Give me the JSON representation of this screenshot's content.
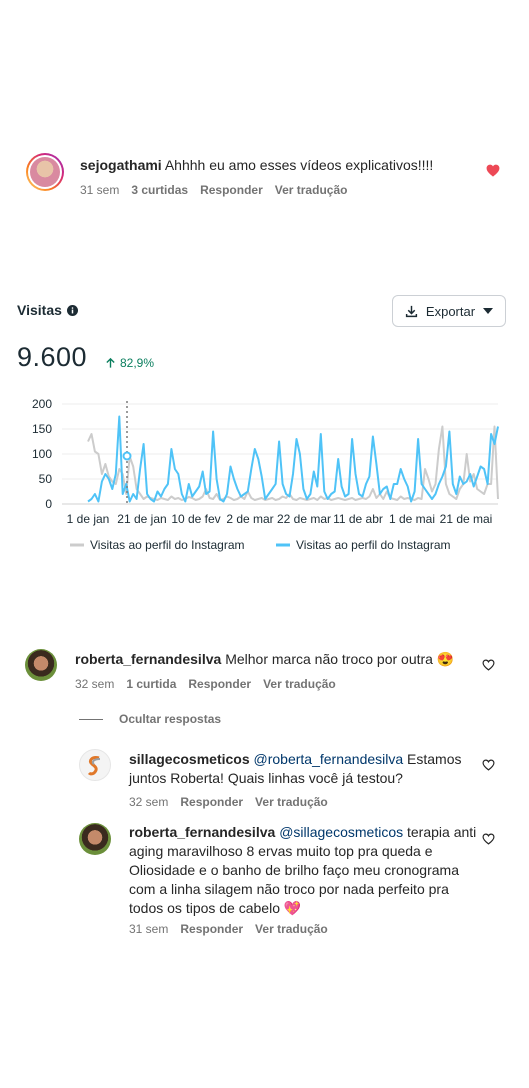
{
  "comment1": {
    "username": "sejogathami",
    "text": "Ahhhh eu amo esses vídeos explicativos!!!!",
    "time": "31 sem",
    "likes": "3 curtidas",
    "reply": "Responder",
    "translate": "Ver tradução",
    "liked": true,
    "like_color": "#ed4956"
  },
  "analytics": {
    "title": "Visitas",
    "info_icon": "info-icon",
    "export_label": "Exportar",
    "total": "9.600",
    "change": "82,9%",
    "change_color": "#0a7e5e"
  },
  "chart_data": {
    "type": "line",
    "y_ticks": [
      "200",
      "150",
      "100",
      "50",
      "0"
    ],
    "ylim": [
      0,
      200
    ],
    "x_ticks": [
      "1 de jan",
      "21 de jan",
      "10 de fev",
      "2 de mar",
      "22 de mar",
      "11 de abr",
      "1 de mai",
      "21 de mai"
    ],
    "grid": true,
    "legend_position": "bottom",
    "series": [
      {
        "name": "Visitas ao perfil do Instagram",
        "color": "#cccccc",
        "values": [
          125,
          140,
          105,
          100,
          60,
          80,
          55,
          45,
          40,
          70,
          60,
          20,
          95,
          75,
          30,
          20,
          10,
          15,
          12,
          10,
          8,
          12,
          10,
          8,
          15,
          10,
          12,
          8,
          10,
          14,
          12,
          8,
          10,
          15,
          30,
          12,
          10,
          20,
          8,
          10,
          15,
          12,
          8,
          10,
          15,
          10,
          25,
          12,
          8,
          10,
          12,
          8,
          10,
          12,
          8,
          10,
          15,
          12,
          20,
          10,
          8,
          12,
          10,
          8,
          10,
          12,
          8,
          15,
          10,
          12,
          8,
          10,
          12,
          10,
          8,
          10,
          12,
          8,
          10,
          12,
          10,
          15,
          30,
          12,
          20,
          10,
          25,
          12,
          10,
          8,
          15,
          10,
          12,
          10,
          8,
          12,
          10,
          70,
          50,
          25,
          40,
          110,
          155,
          40,
          20,
          15,
          10,
          30,
          40,
          100,
          45,
          60,
          30,
          25,
          20,
          40,
          40,
          155,
          10
        ]
      },
      {
        "name": "Visitas ao perfil do Instagram",
        "color": "#4fc3f7",
        "values": [
          5,
          10,
          20,
          5,
          45,
          60,
          50,
          30,
          60,
          175,
          20,
          40,
          5,
          20,
          10,
          70,
          120,
          20,
          10,
          5,
          25,
          15,
          30,
          40,
          110,
          70,
          60,
          20,
          5,
          40,
          15,
          25,
          35,
          65,
          20,
          25,
          145,
          50,
          10,
          5,
          20,
          75,
          50,
          30,
          15,
          20,
          25,
          70,
          110,
          90,
          55,
          10,
          20,
          30,
          40,
          125,
          40,
          20,
          15,
          60,
          130,
          100,
          30,
          10,
          20,
          65,
          35,
          140,
          25,
          10,
          20,
          25,
          90,
          35,
          15,
          20,
          130,
          60,
          20,
          15,
          40,
          55,
          135,
          80,
          20,
          30,
          35,
          10,
          40,
          40,
          70,
          50,
          35,
          5,
          25,
          130,
          40,
          30,
          20,
          10,
          20,
          40,
          55,
          75,
          145,
          40,
          20,
          55,
          40,
          45,
          60,
          35,
          55,
          75,
          70,
          40,
          140,
          120,
          155
        ]
      }
    ]
  },
  "comment2": {
    "username": "roberta_fernandesilva",
    "text": "Melhor marca não troco por outra 😍",
    "time": "32 sem",
    "likes": "1 curtida",
    "reply": "Responder",
    "translate": "Ver tradução",
    "hide_replies": "Ocultar respostas"
  },
  "reply1": {
    "username": "sillagecosmeticos",
    "mention": "@roberta_fernandesilva",
    "text_line1": "Estamos",
    "text_line2": "juntos Roberta! Quais linhas você já testou?",
    "time": "32 sem",
    "reply": "Responder",
    "translate": "Ver tradução"
  },
  "reply2": {
    "username": "roberta_fernandesilva",
    "mention": "@sillagecosmeticos",
    "text_line1": "terapia anti",
    "text_line2": "aging maravilhoso 8 ervas muito top pra queda e",
    "text_line3": "Oliosidade e o banho de brilho faço meu cronograma",
    "text_line4": "com a linha silagem não troco por nada perfeito pra",
    "text_line5": "todos os tipos de cabelo 💖",
    "time": "31 sem",
    "reply": "Responder",
    "translate": "Ver tradução"
  }
}
